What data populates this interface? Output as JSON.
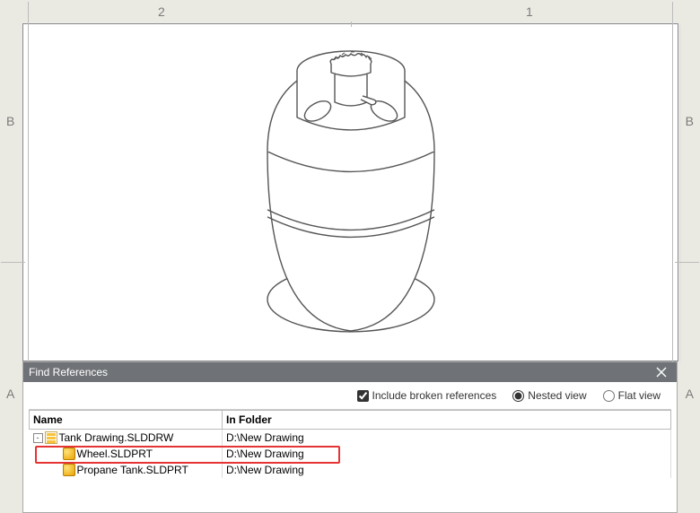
{
  "zones": {
    "top_left": "2",
    "top_right": "1",
    "side_b": "B",
    "side_a": "A"
  },
  "panel": {
    "title": "Find References",
    "options": {
      "include_broken": "Include broken references",
      "include_broken_checked": true,
      "nested": "Nested view",
      "flat": "Flat view",
      "view_mode": "nested"
    },
    "columns": {
      "name": "Name",
      "folder": "In Folder"
    },
    "rows": [
      {
        "level": 0,
        "icon": "drw",
        "expand": "-",
        "name": "Tank Drawing.SLDDRW",
        "folder": "D:\\New Drawing",
        "highlight": false
      },
      {
        "level": 1,
        "icon": "part",
        "expand": "",
        "name": "Wheel.SLDPRT",
        "folder": "D:\\New Drawing",
        "highlight": true
      },
      {
        "level": 1,
        "icon": "part",
        "expand": "",
        "name": "Propane Tank.SLDPRT",
        "folder": "D:\\New Drawing",
        "highlight": false
      }
    ]
  }
}
